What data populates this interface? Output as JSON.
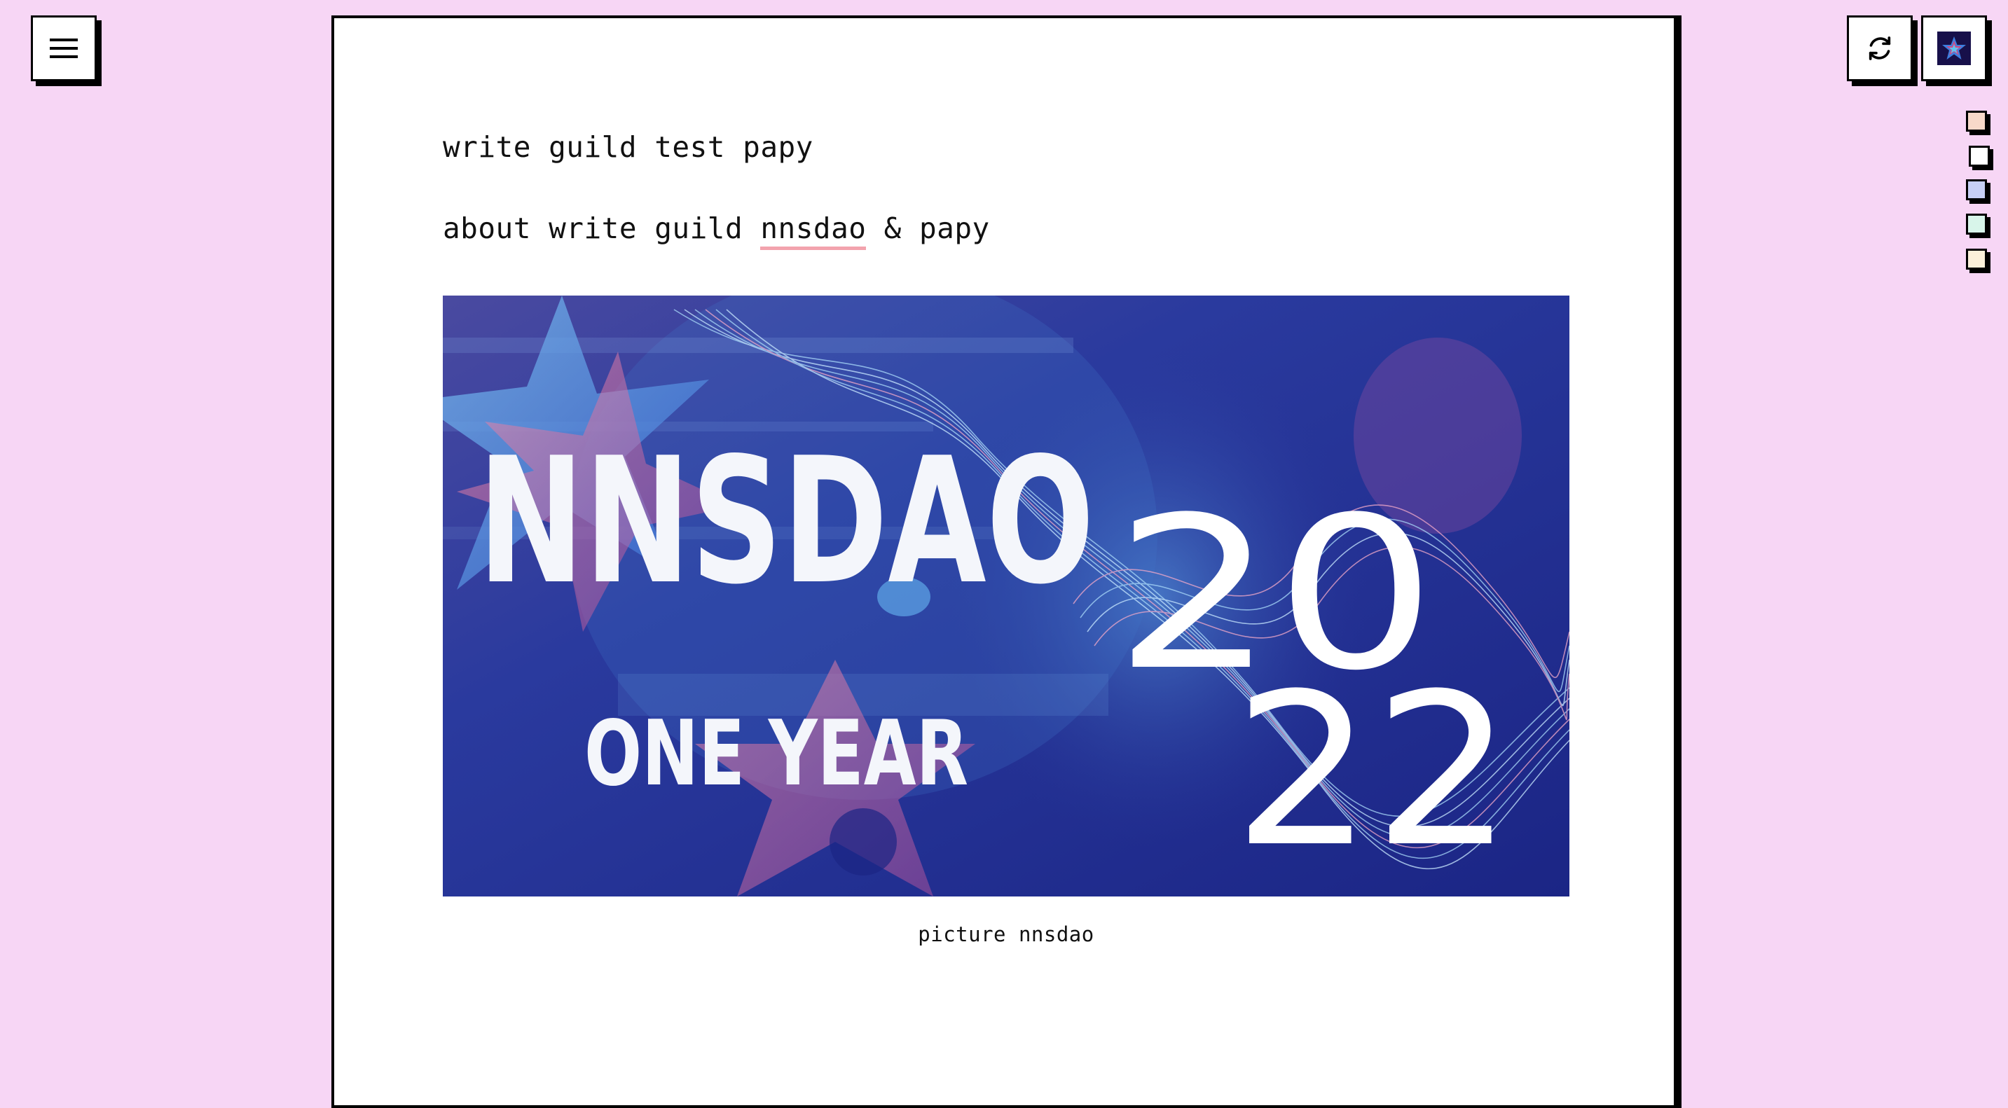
{
  "toolbar": {
    "menu_icon": "hamburger-menu-icon",
    "refresh_icon": "refresh-icon",
    "logo_icon": "nnsdao-star-logo-icon"
  },
  "theme_swatches": [
    {
      "name": "peach",
      "color": "#f7d9c9"
    },
    {
      "name": "white",
      "color": "#ffffff"
    },
    {
      "name": "lavender",
      "color": "#c7cff5"
    },
    {
      "name": "mint",
      "color": "#d8f5ea"
    },
    {
      "name": "cream",
      "color": "#fbf0da"
    }
  ],
  "document": {
    "title": "write guild test papy",
    "about_prefix": "about write guild ",
    "about_link": "nnsdao",
    "about_suffix": " & papy",
    "banner": {
      "headline": "NNSDAO",
      "subtitle": "ONE YEAR",
      "year_top": "20",
      "year_bottom": "22"
    },
    "caption": "picture nnsdao"
  },
  "colors": {
    "page_background": "#f7d6f5",
    "paper": "#ffffff",
    "link_underline": "#f3a3ad",
    "banner_blue": "#1e2a8a"
  }
}
